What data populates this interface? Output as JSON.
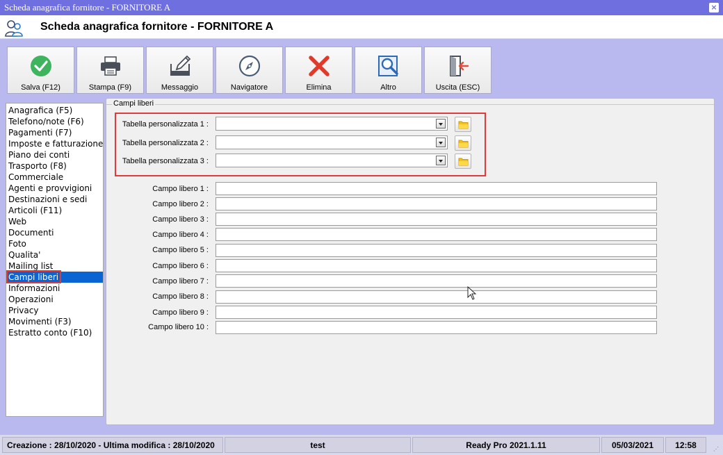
{
  "window": {
    "title": "Scheda anagrafica fornitore - FORNITORE A",
    "close_glyph": "×"
  },
  "header": {
    "title": "Scheda anagrafica fornitore - FORNITORE A",
    "icon": "users-icon"
  },
  "toolbar": {
    "buttons": [
      {
        "label": "Salva (F12)",
        "icon": "check-circle-icon",
        "color": "#3fb45f"
      },
      {
        "label": "Stampa (F9)",
        "icon": "printer-icon",
        "color": "#4a4f5a"
      },
      {
        "label": "Messaggio",
        "icon": "compose-icon",
        "color": "#4a4f5a"
      },
      {
        "label": "Navigatore",
        "icon": "compass-icon",
        "color": "#4a5d75"
      },
      {
        "label": "Elimina",
        "icon": "x-icon",
        "color": "#e23a2a"
      },
      {
        "label": "Altro",
        "icon": "magnifier-document-icon",
        "color": "#2a6ab8"
      },
      {
        "label": "Uscita (ESC)",
        "icon": "exit-door-icon",
        "color": "#e24a3a"
      }
    ]
  },
  "sidebar": {
    "items": [
      {
        "label": "Anagrafica (F5)"
      },
      {
        "label": "Telefono/note (F6)"
      },
      {
        "label": "Pagamenti (F7)"
      },
      {
        "label": "Imposte e fatturazione"
      },
      {
        "label": "Piano dei conti"
      },
      {
        "label": "Trasporto (F8)"
      },
      {
        "label": "Commerciale"
      },
      {
        "label": "Agenti e provvigioni"
      },
      {
        "label": "Destinazioni e sedi"
      },
      {
        "label": "Articoli (F11)"
      },
      {
        "label": "Web"
      },
      {
        "label": "Documenti"
      },
      {
        "label": "Foto"
      },
      {
        "label": "Qualita'"
      },
      {
        "label": "Mailing list"
      },
      {
        "label": "Campi liberi"
      },
      {
        "label": "Informazioni"
      },
      {
        "label": "Operazioni"
      },
      {
        "label": "Privacy"
      },
      {
        "label": "Movimenti (F3)"
      },
      {
        "label": "Estratto conto (F10)"
      }
    ],
    "selected": "Campi liberi"
  },
  "panel": {
    "legend": "Campi liberi",
    "custom_tables": [
      {
        "label": "Tabella personalizzata 1 :",
        "value": ""
      },
      {
        "label": "Tabella personalizzata 2 :",
        "value": ""
      },
      {
        "label": "Tabella personalizzata 3 :",
        "value": ""
      }
    ],
    "free_fields": [
      {
        "label": "Campo libero 1 :",
        "value": ""
      },
      {
        "label": "Campo libero 2 :",
        "value": ""
      },
      {
        "label": "Campo libero 3 :",
        "value": ""
      },
      {
        "label": "Campo libero 4 :",
        "value": ""
      },
      {
        "label": "Campo libero 5 :",
        "value": ""
      },
      {
        "label": "Campo libero 6 :",
        "value": ""
      },
      {
        "label": "Campo libero 7 :",
        "value": ""
      },
      {
        "label": "Campo libero 8 :",
        "value": ""
      },
      {
        "label": "Campo libero 9 :",
        "value": ""
      },
      {
        "label": "Campo libero 10 :",
        "value": ""
      }
    ]
  },
  "statusbar": {
    "dates": "Creazione : 28/10/2020 - Ultima modifica : 28/10/2020",
    "user": "test",
    "product": "Ready Pro 2021.1.11",
    "date": "05/03/2021",
    "time": "12:58"
  },
  "colors": {
    "titlebar": "#6f6fe0",
    "background": "#b9b9f0",
    "selection": "#0a64d2",
    "highlight": "#e23a3a"
  }
}
